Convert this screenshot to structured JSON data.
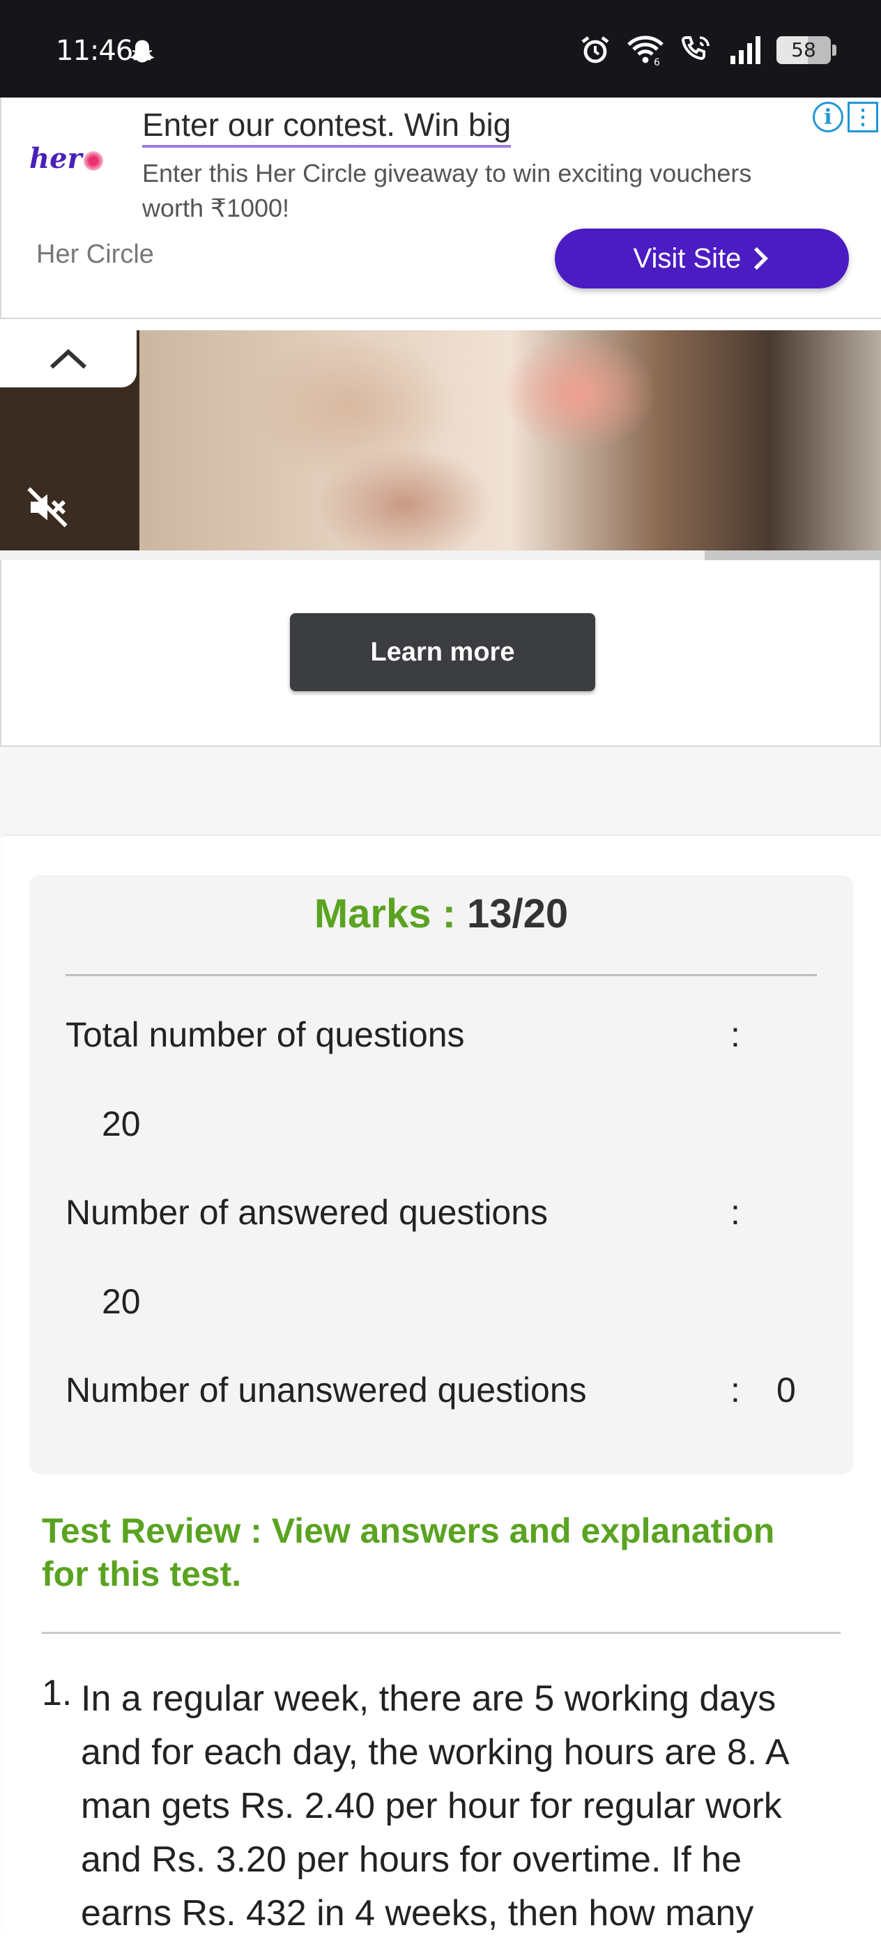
{
  "status_bar": {
    "time": "11:46",
    "battery": "58",
    "icons": [
      "snapchat-ghost-icon",
      "alarm-icon",
      "wifi-icon",
      "wifi-call-icon",
      "signal-icon",
      "battery-icon"
    ]
  },
  "ad_banner": {
    "headline": "Enter our contest. Win big",
    "description": "Enter this Her Circle giveaway to win exciting vouchers worth ₹1000!",
    "brand": "Her Circle",
    "logo_text": "her",
    "cta": "Visit Site",
    "accent_color": "#4b1cc2"
  },
  "video_ad": {
    "progress_fraction": 0.8,
    "cta": "Learn more"
  },
  "result": {
    "marks_label": "Marks :",
    "marks_value": "13/20",
    "rows": [
      {
        "label": "Total number of questions",
        "sep": ":",
        "value": "20"
      },
      {
        "label": "Number of answered questions",
        "sep": ":",
        "value": "20"
      },
      {
        "label": "Number of unanswered questions",
        "sep": ":",
        "value": "0"
      }
    ],
    "accent_color": "#5aa321"
  },
  "review": {
    "heading": "Test Review : View answers and explanation for this test.",
    "questions": [
      {
        "number": "1.",
        "text": "In a regular week, there are 5 working days and for each day, the working hours are 8. A man gets Rs. 2.40 per hour for regular work and Rs. 3.20 per hours for overtime. If he earns Rs. 432 in 4 weeks, then how many"
      }
    ]
  }
}
